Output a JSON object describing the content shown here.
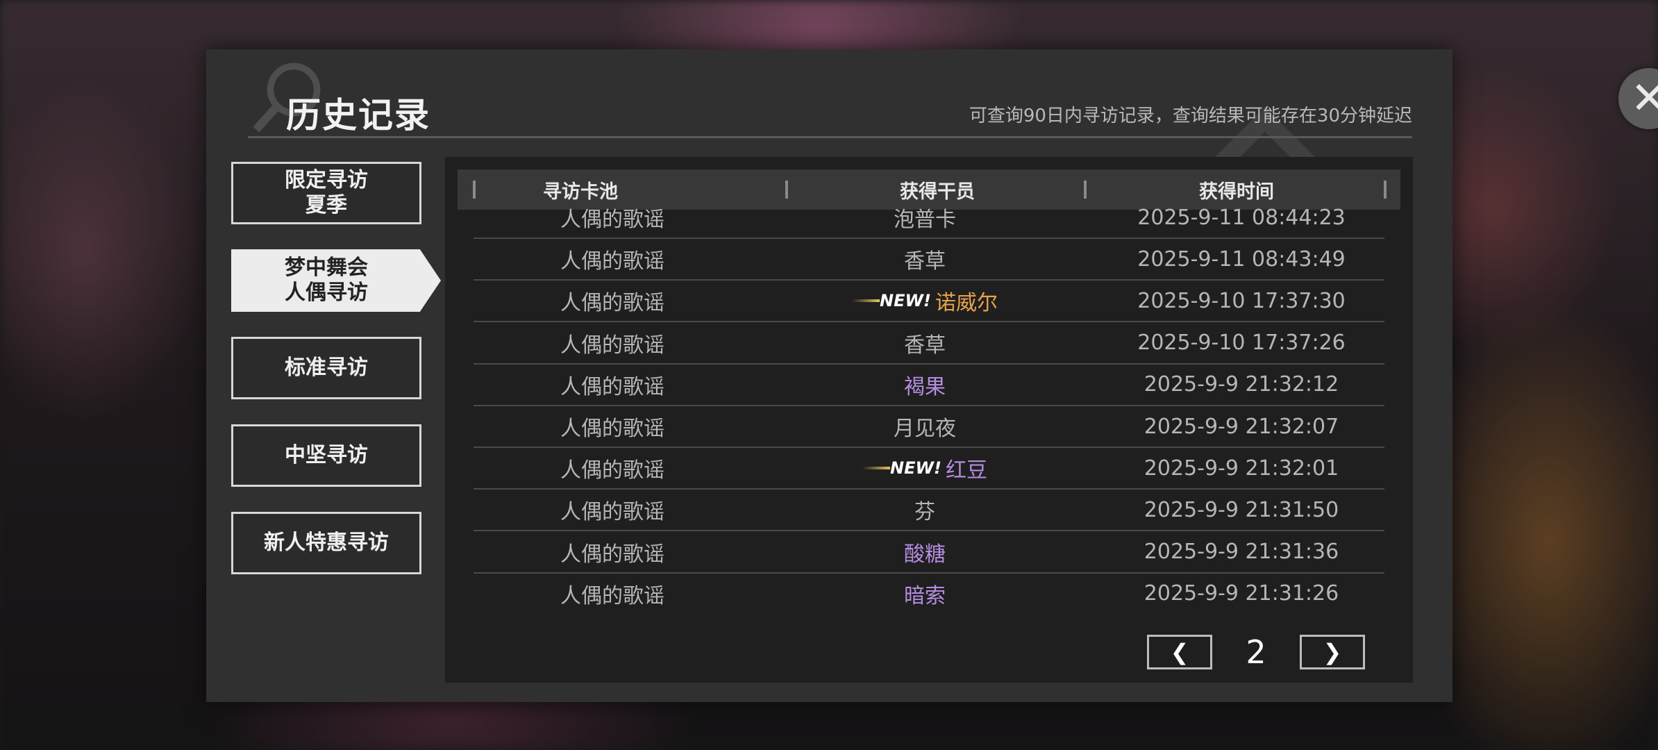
{
  "header": {
    "title": "历史记录",
    "subtitle": "可查询90日内寻访记录，查询结果可能存在30分钟延迟"
  },
  "tabs": [
    {
      "label": "限定寻访\n夏季",
      "active": false
    },
    {
      "label": "梦中舞会\n人偶寻访",
      "active": true
    },
    {
      "label": "标准寻访",
      "active": false
    },
    {
      "label": "中坚寻访",
      "active": false
    },
    {
      "label": "新人特惠寻访",
      "active": false
    }
  ],
  "table": {
    "columns": [
      "寻访卡池",
      "获得干员",
      "获得时间"
    ],
    "rows": [
      {
        "pool": "人偶的歌谣",
        "operator": "泡普卡",
        "time": "2025-9-11 08:44:23",
        "new": "",
        "color": "#b6b6b6"
      },
      {
        "pool": "人偶的歌谣",
        "operator": "香草",
        "time": "2025-9-11 08:43:49",
        "new": "",
        "color": "#b6b6b6"
      },
      {
        "pool": "人偶的歌谣",
        "operator": "诺威尔",
        "time": "2025-9-10 17:37:30",
        "new": "NEW!",
        "color": "#e8a24a"
      },
      {
        "pool": "人偶的歌谣",
        "operator": "香草",
        "time": "2025-9-10 17:37:26",
        "new": "",
        "color": "#b6b6b6"
      },
      {
        "pool": "人偶的歌谣",
        "operator": "褐果",
        "time": "2025-9-9 21:32:12",
        "new": "",
        "color": "#b58de0"
      },
      {
        "pool": "人偶的歌谣",
        "operator": "月见夜",
        "time": "2025-9-9 21:32:07",
        "new": "",
        "color": "#b6b6b6"
      },
      {
        "pool": "人偶的歌谣",
        "operator": "红豆",
        "time": "2025-9-9 21:32:01",
        "new": "NEW!",
        "color": "#b58de0"
      },
      {
        "pool": "人偶的歌谣",
        "operator": "芬",
        "time": "2025-9-9 21:31:50",
        "new": "",
        "color": "#b6b6b6"
      },
      {
        "pool": "人偶的歌谣",
        "operator": "酸糖",
        "time": "2025-9-9 21:31:36",
        "new": "",
        "color": "#b58de0"
      },
      {
        "pool": "人偶的歌谣",
        "operator": "暗索",
        "time": "2025-9-9 21:31:26",
        "new": "",
        "color": "#b58de0"
      }
    ]
  },
  "pagination": {
    "current_page": "2",
    "prev_icon": "chevron-left-icon",
    "next_icon": "chevron-right-icon"
  },
  "close_icon": "close-icon"
}
